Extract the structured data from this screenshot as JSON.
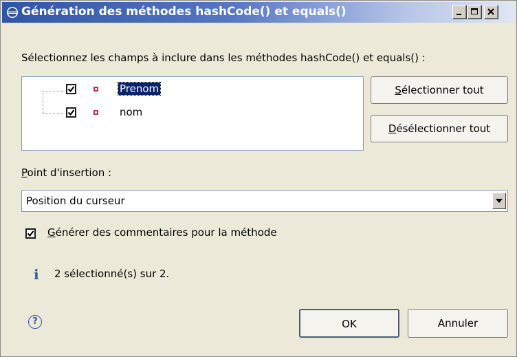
{
  "window": {
    "title": "Génération des méthodes hashCode() et equals()",
    "icon": "eclipse-icon"
  },
  "prompt": "Sélectionnez les champs à inclure dans les méthodes hashCode() et equals() :",
  "fields": [
    {
      "label": "Prenom",
      "checked": true,
      "selected": true
    },
    {
      "label": "nom",
      "checked": true,
      "selected": false
    }
  ],
  "buttons": {
    "select_all_accel": "S",
    "select_all_rest": "électionner tout",
    "deselect_all_accel": "D",
    "deselect_all_rest": "ésélectionner tout",
    "ok": "OK",
    "cancel": "Annuler"
  },
  "insertion": {
    "label_accel": "P",
    "label_rest": "oint d'insertion :",
    "value": "Position du curseur"
  },
  "generate_comments": {
    "checked": true,
    "label_accel": "G",
    "label_rest": "énérer des commentaires pour la méthode"
  },
  "status": {
    "icon": "info-icon",
    "text": "2 sélectionné(s) sur 2."
  },
  "colors": {
    "titlebar_start": "#2f56a6",
    "dialog_bg": "#ece9d8",
    "selection_bg": "#0a246a",
    "field_icon": "#c0304a"
  }
}
